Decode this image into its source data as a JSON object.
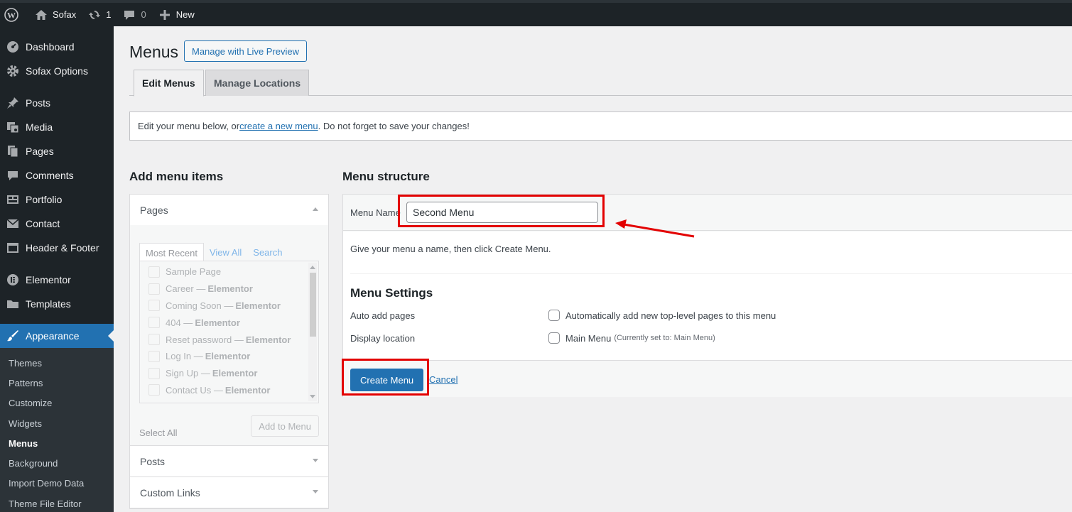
{
  "adminbar": {
    "site_name": "Sofax",
    "updates_count": "1",
    "comments_count": "0",
    "new_label": "New"
  },
  "sidebar": {
    "items": [
      {
        "label": "Dashboard",
        "icon": "dashboard-icon"
      },
      {
        "label": "Sofax Options",
        "icon": "gear-icon"
      },
      {
        "label": "Posts",
        "icon": "pin-icon"
      },
      {
        "label": "Media",
        "icon": "media-icon"
      },
      {
        "label": "Pages",
        "icon": "pages-icon"
      },
      {
        "label": "Comments",
        "icon": "comment-icon"
      },
      {
        "label": "Portfolio",
        "icon": "portfolio-icon"
      },
      {
        "label": "Contact",
        "icon": "mail-icon"
      },
      {
        "label": "Header & Footer",
        "icon": "layout-icon"
      },
      {
        "label": "Elementor",
        "icon": "elementor-icon"
      },
      {
        "label": "Templates",
        "icon": "folder-icon"
      },
      {
        "label": "Appearance",
        "icon": "brush-icon"
      }
    ],
    "submenu": [
      "Themes",
      "Patterns",
      "Customize",
      "Widgets",
      "Menus",
      "Background",
      "Import Demo Data",
      "Theme File Editor"
    ]
  },
  "page": {
    "title": "Menus",
    "live_preview_label": "Manage with Live Preview",
    "tabs": [
      "Edit Menus",
      "Manage Locations"
    ],
    "notice_before": "Edit your menu below, or ",
    "notice_link": "create a new menu",
    "notice_after": ". Do not forget to save your changes!"
  },
  "add_items": {
    "title": "Add menu items",
    "pages_label": "Pages",
    "tabs": [
      "Most Recent",
      "View All",
      "Search"
    ],
    "pages": [
      {
        "name": "Sample Page",
        "suffix": ""
      },
      {
        "name": "Career — ",
        "suffix": "Elementor"
      },
      {
        "name": "Coming Soon — ",
        "suffix": "Elementor"
      },
      {
        "name": "404 — ",
        "suffix": "Elementor"
      },
      {
        "name": "Reset password — ",
        "suffix": "Elementor"
      },
      {
        "name": "Log In — ",
        "suffix": "Elementor"
      },
      {
        "name": "Sign Up — ",
        "suffix": "Elementor"
      },
      {
        "name": "Contact Us — ",
        "suffix": "Elementor"
      }
    ],
    "select_all": "Select All",
    "add_to_menu": "Add to Menu",
    "posts_label": "Posts",
    "custom_links_label": "Custom Links"
  },
  "structure": {
    "title": "Menu structure",
    "menu_name_label": "Menu Name",
    "menu_name_value": "Second Menu",
    "instructions": "Give your menu a name, then click Create Menu.",
    "settings_title": "Menu Settings",
    "auto_add_label": "Auto add pages",
    "auto_add_text": "Automatically add new top-level pages to this menu",
    "display_location_label": "Display location",
    "main_menu_text": "Main Menu",
    "main_menu_note": "(Currently set to: Main Menu)",
    "create_label": "Create Menu",
    "cancel_label": "Cancel"
  },
  "colors": {
    "accent": "#2271b1",
    "adminbar_bg": "#1d2327",
    "annotation_red": "#e30000"
  }
}
